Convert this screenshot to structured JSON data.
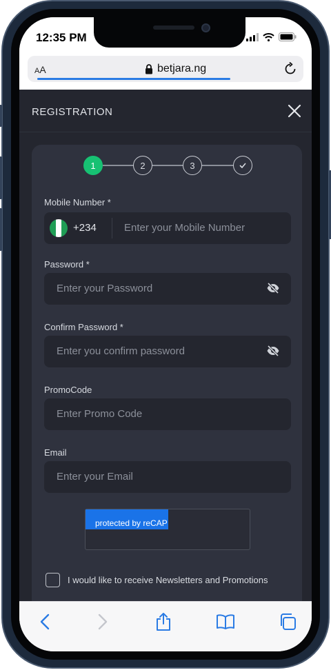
{
  "status_bar": {
    "time": "12:35 PM"
  },
  "browser": {
    "text_size_label_small": "A",
    "text_size_label_large": "A",
    "url": "betjara.ng"
  },
  "registration": {
    "title": "REGISTRATION",
    "steps": [
      "1",
      "2",
      "3"
    ],
    "active_step": "1",
    "mobile": {
      "label": "Mobile Number *",
      "dial_code": "+234",
      "placeholder": "Enter your Mobile Number"
    },
    "password": {
      "label": "Password *",
      "placeholder": "Enter your Password"
    },
    "confirm_password": {
      "label": "Confirm Password *",
      "placeholder": "Enter you confirm password"
    },
    "promo": {
      "label": "PromoCode",
      "placeholder": "Enter Promo Code"
    },
    "email": {
      "label": "Email",
      "placeholder": "Enter your Email"
    },
    "recaptcha_text": "protected by reCAP",
    "newsletter_label": "I would like to receive Newsletters and Promotions"
  },
  "colors": {
    "accent_green": "#17c173",
    "page_bg": "#24262f",
    "card_bg": "#2f323e",
    "recaptcha_blue": "#1a73e8",
    "link_blue": "#2a7be4",
    "flag_green": "#1f9d55"
  },
  "icons": {
    "close": "close-icon",
    "eye": "eye-slash-icon",
    "back": "chevron-left-icon",
    "forward": "chevron-right-icon",
    "share": "share-icon",
    "bookmarks": "book-icon",
    "tabs": "tabs-icon",
    "lock": "lock-icon",
    "reload": "reload-icon",
    "check": "check-icon"
  }
}
